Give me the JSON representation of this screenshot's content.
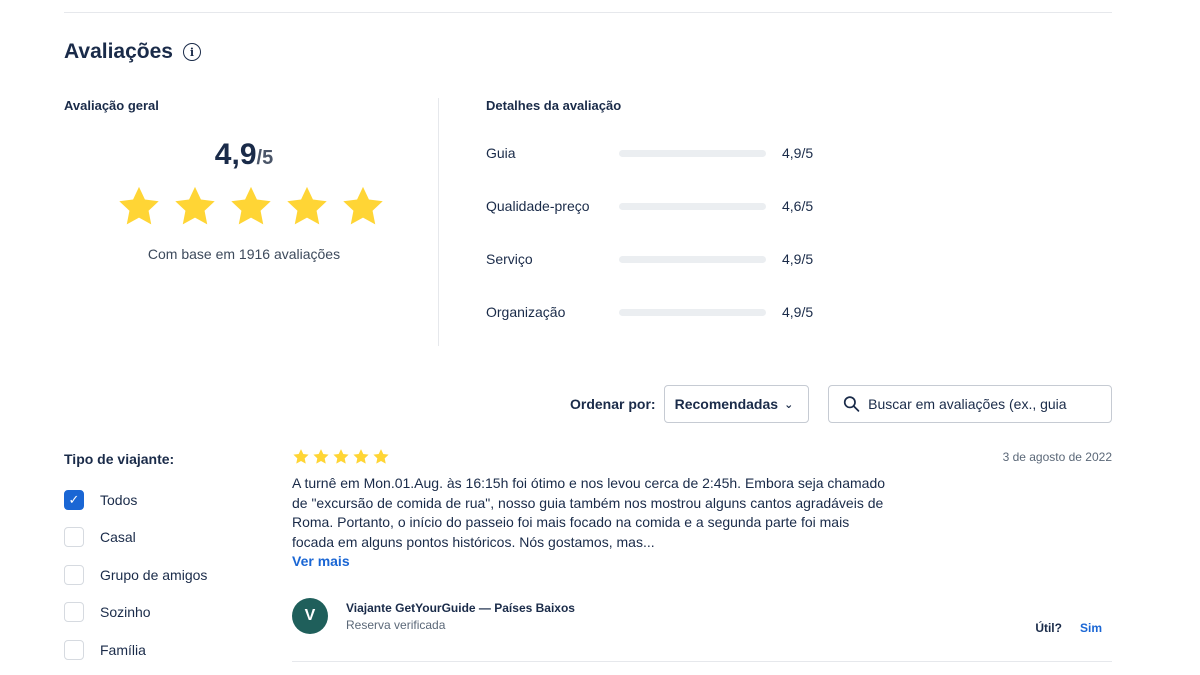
{
  "section": {
    "title": "Avaliações"
  },
  "overall": {
    "label": "Avaliação geral",
    "score": "4,9",
    "out_of": "/5",
    "stars": 5,
    "based_on": "Com base em 1916 avaliações",
    "star_color": "#ffd535"
  },
  "details": {
    "label": "Detalhes da avaliação",
    "items": [
      {
        "name": "Guia",
        "value": "4,9/5",
        "rating": 4.9
      },
      {
        "name": "Qualidade-preço",
        "value": "4,6/5",
        "rating": 4.6
      },
      {
        "name": "Serviço",
        "value": "4,9/5",
        "rating": 4.9
      },
      {
        "name": "Organização",
        "value": "4,9/5",
        "rating": 4.9
      }
    ]
  },
  "sort": {
    "label": "Ordenar por:",
    "selected": "Recomendadas"
  },
  "search": {
    "placeholder": "Buscar em avaliações (ex., guia"
  },
  "filters": {
    "title": "Tipo de viajante:",
    "items": [
      {
        "label": "Todos",
        "checked": true
      },
      {
        "label": "Casal",
        "checked": false
      },
      {
        "label": "Grupo de amigos",
        "checked": false
      },
      {
        "label": "Sozinho",
        "checked": false
      },
      {
        "label": "Família",
        "checked": false
      }
    ]
  },
  "review": {
    "stars": 5,
    "date": "3 de agosto de 2022",
    "text": "A turnê em Mon.01.Aug. às 16:15h foi ótimo e nos levou cerca de 2:45h. Embora seja chamado de \"excursão de comida de rua\", nosso guia também nos mostrou alguns cantos agradáveis de Roma. Portanto, o início do passeio foi mais focado na comida e a segunda parte foi mais focada em alguns pontos históricos. Nós gostamos, mas...",
    "more": "Ver mais",
    "avatar_initial": "V",
    "author": "Viajante GetYourGuide — Países Baixos",
    "verified": "Reserva verificada",
    "helpful_q": "Útil?",
    "helpful_yes": "Sim"
  },
  "colors": {
    "accent": "#1a66d4",
    "navy": "#1a2b49",
    "star": "#ffd535",
    "avatar": "#1f5f5b"
  }
}
